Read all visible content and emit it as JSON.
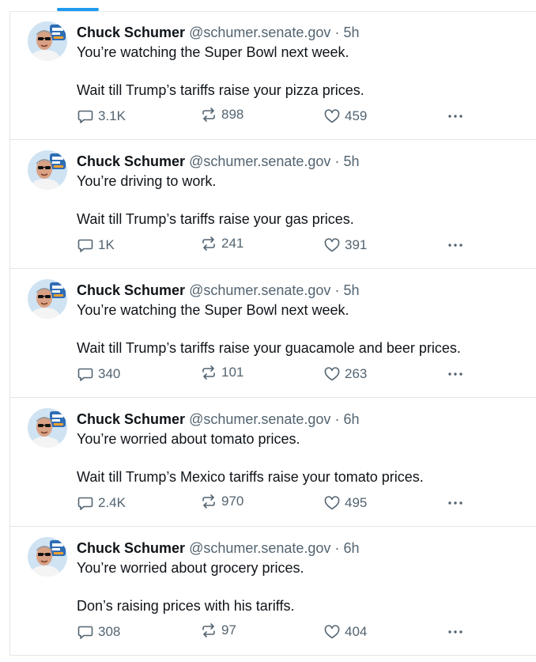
{
  "colors": {
    "accent": "#1d9bf0",
    "text": "#0f1419",
    "muted": "#536471",
    "divider": "#e3e7ea"
  },
  "icons": {
    "reply": "reply-icon",
    "repost": "repost-icon",
    "like": "heart-icon",
    "more": "more-icon"
  },
  "posts": [
    {
      "name": "Chuck Schumer",
      "handle": "@schumer.senate.gov",
      "dot": "·",
      "time": "5h",
      "line1": "You’re watching the Super Bowl next week.",
      "line2": "Wait till Trump’s tariffs raise your pizza prices.",
      "replies": "3.1K",
      "reposts": "898",
      "likes": "459"
    },
    {
      "name": "Chuck Schumer",
      "handle": "@schumer.senate.gov",
      "dot": "·",
      "time": "5h",
      "line1": "You’re driving to work.",
      "line2": "Wait till Trump’s tariffs raise your gas prices.",
      "replies": "1K",
      "reposts": "241",
      "likes": "391"
    },
    {
      "name": "Chuck Schumer",
      "handle": "@schumer.senate.gov",
      "dot": "·",
      "time": "5h",
      "line1": "You’re watching the Super Bowl next week.",
      "line2": "Wait till Trump’s tariffs raise your guacamole and beer prices.",
      "replies": "340",
      "reposts": "101",
      "likes": "263"
    },
    {
      "name": "Chuck Schumer",
      "handle": "@schumer.senate.gov",
      "dot": "·",
      "time": "6h",
      "line1": "You’re worried about tomato prices.",
      "line2": "Wait till Trump’s Mexico tariffs raise your tomato prices.",
      "replies": "2.4K",
      "reposts": "970",
      "likes": "495"
    },
    {
      "name": "Chuck Schumer",
      "handle": "@schumer.senate.gov",
      "dot": "·",
      "time": "6h",
      "line1": "You’re worried about grocery prices.",
      "line2": "Don’s raising prices with his tariffs.",
      "replies": "308",
      "reposts": "97",
      "likes": "404"
    }
  ]
}
